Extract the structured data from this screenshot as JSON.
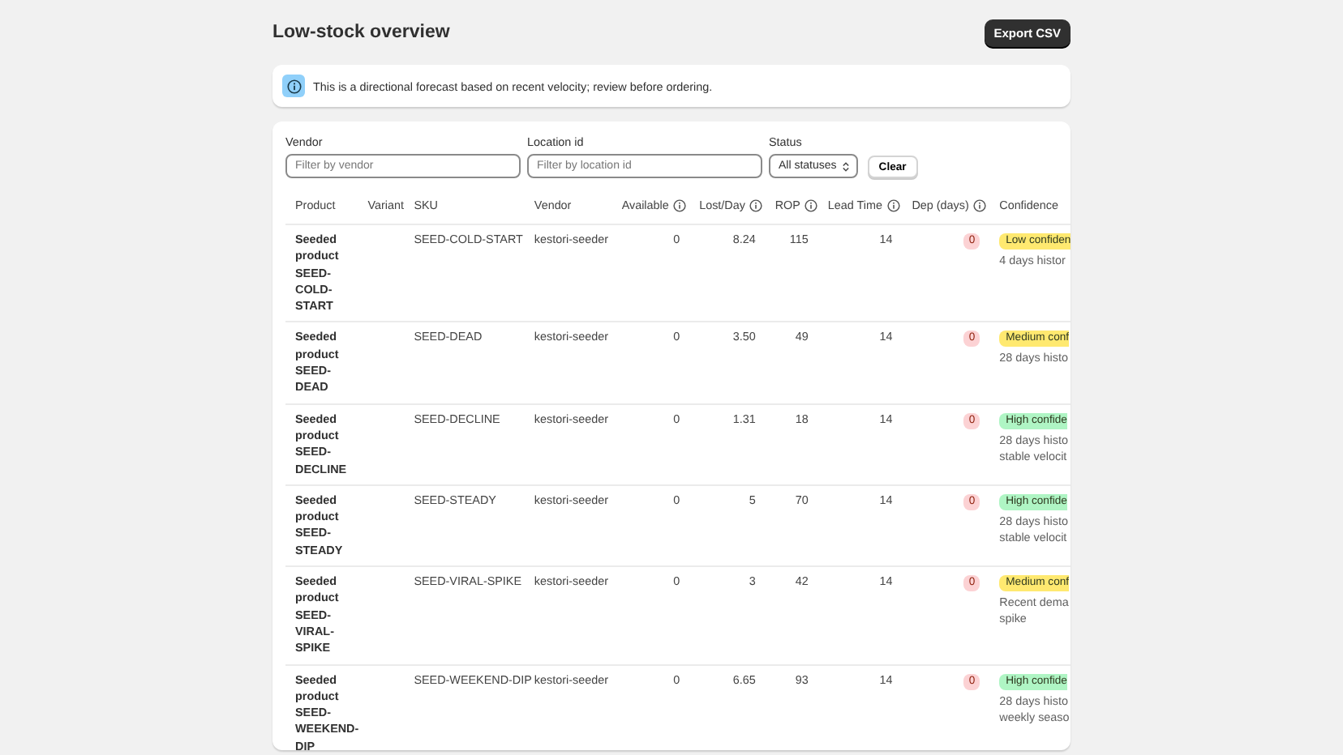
{
  "page": {
    "title": "Low-stock overview",
    "export_button": "Export CSV"
  },
  "notice": {
    "text": "This is a directional forecast based on recent velocity; review before ordering."
  },
  "filters": [
    {
      "kind": "text",
      "label": "Vendor",
      "placeholder": "Filter by vendor"
    },
    {
      "kind": "text",
      "label": "Location id",
      "placeholder": "Filter by location id"
    },
    {
      "kind": "select",
      "label": "Status",
      "value": "All statuses"
    }
  ],
  "clear_button": "Clear",
  "table": {
    "columns": [
      {
        "label": "Product",
        "info": false
      },
      {
        "label": "Variant",
        "info": false
      },
      {
        "label": "SKU",
        "info": false
      },
      {
        "label": "Vendor",
        "info": false
      },
      {
        "label": "Available",
        "info": true
      },
      {
        "label": "Lost/Day",
        "info": true
      },
      {
        "label": "ROP",
        "info": true
      },
      {
        "label": "Lead Time",
        "info": true
      },
      {
        "label": "Dep (days)",
        "info": true
      },
      {
        "label": "Confidence",
        "info": false
      }
    ],
    "rows": [
      {
        "product": "Seeded product SEED-COLD-START",
        "sku": "SEED-COLD-START",
        "vendor": "kestori-seeder",
        "available": "0",
        "lost_per_day": "8.24",
        "rop": "115",
        "lead_time": "14",
        "dep_days": "0",
        "confidence": {
          "label": "Low confiden",
          "color": "#ffe970"
        },
        "note_lines": [
          "4 days histor"
        ]
      },
      {
        "product": "Seeded product SEED-DEAD",
        "sku": "SEED-DEAD",
        "vendor": "kestori-seeder",
        "available": "0",
        "lost_per_day": "3.50",
        "rop": "49",
        "lead_time": "14",
        "dep_days": "0",
        "confidence": {
          "label": "Medium conf",
          "color": "#ffe970"
        },
        "note_lines": [
          "28 days histo"
        ]
      },
      {
        "product": "Seeded product SEED-DECLINE",
        "sku": "SEED-DECLINE",
        "vendor": "kestori-seeder",
        "available": "0",
        "lost_per_day": "1.31",
        "rop": "18",
        "lead_time": "14",
        "dep_days": "0",
        "confidence": {
          "label": "High confide",
          "color": "#aff5c4"
        },
        "note_lines": [
          "28 days histo",
          "stable velocit"
        ]
      },
      {
        "product": "Seeded product SEED-STEADY",
        "sku": "SEED-STEADY",
        "vendor": "kestori-seeder",
        "available": "0",
        "lost_per_day": "5",
        "rop": "70",
        "lead_time": "14",
        "dep_days": "0",
        "confidence": {
          "label": "High confide",
          "color": "#aff5c4"
        },
        "note_lines": [
          "28 days histo",
          "stable velocit"
        ]
      },
      {
        "product": "Seeded product SEED-VIRAL-SPIKE",
        "sku": "SEED-VIRAL-SPIKE",
        "vendor": "kestori-seeder",
        "available": "0",
        "lost_per_day": "3",
        "rop": "42",
        "lead_time": "14",
        "dep_days": "0",
        "confidence": {
          "label": "Medium conf",
          "color": "#ffe970"
        },
        "note_lines": [
          "Recent dema",
          "spike"
        ]
      },
      {
        "product": "Seeded product SEED-WEEKEND-DIP",
        "sku": "SEED-WEEKEND-DIP",
        "vendor": "kestori-seeder",
        "available": "0",
        "lost_per_day": "6.65",
        "rop": "93",
        "lead_time": "14",
        "dep_days": "0",
        "confidence": {
          "label": "High confide",
          "color": "#aff5c4"
        },
        "note_lines": [
          "28 days histo",
          "weekly seaso"
        ]
      }
    ]
  }
}
